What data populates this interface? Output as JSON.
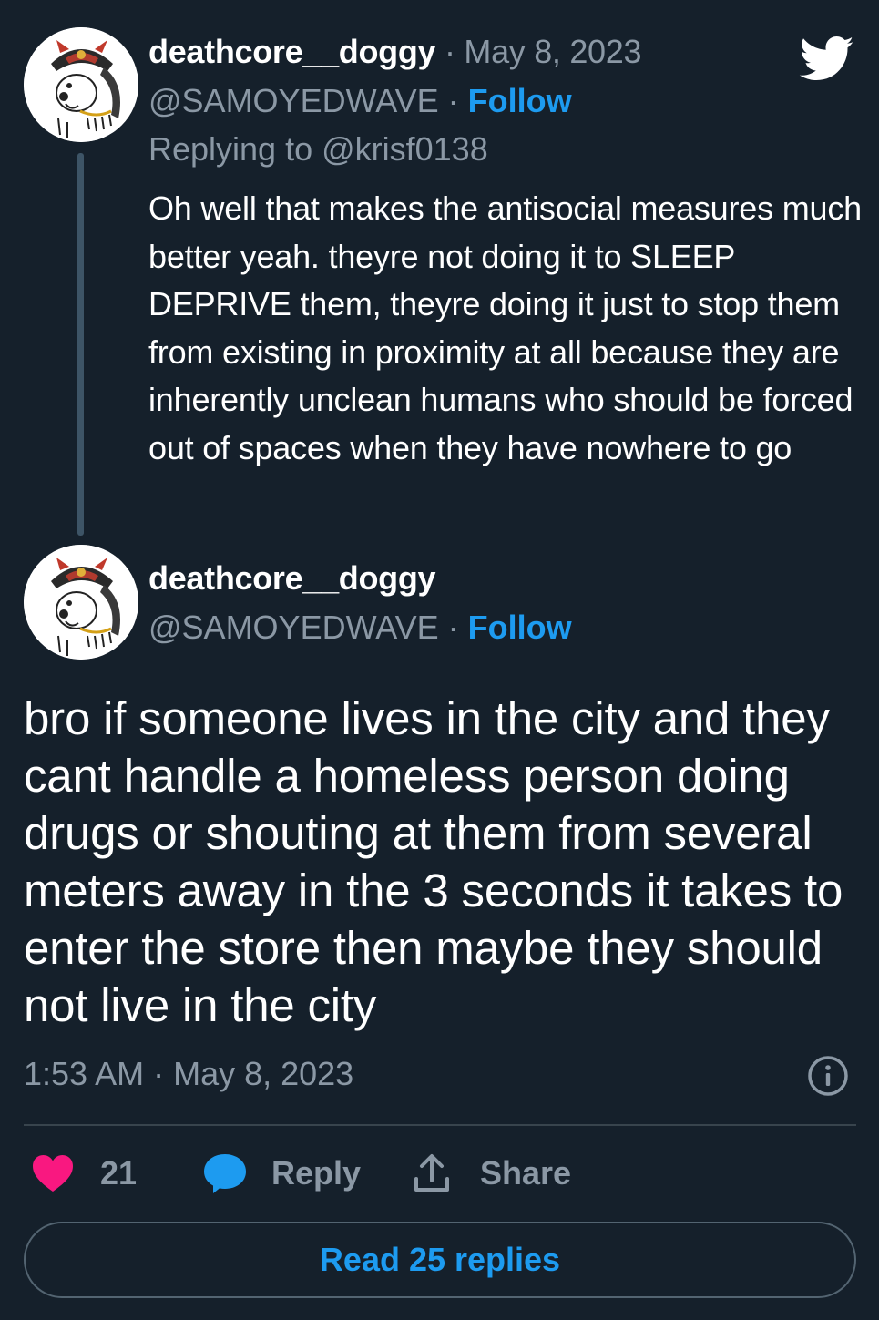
{
  "reply_tweet": {
    "display_name": "deathcore__doggy",
    "date": "May 8, 2023",
    "handle": "@SAMOYEDWAVE",
    "follow_label": "Follow",
    "replying_to": "Replying to @krisf0138",
    "text": "Oh well that makes the antisocial measures much better yeah. theyre not doing it to SLEEP DEPRIVE them, theyre doing it just to stop them from existing in proximity at all because they are inherently unclean humans who should be forced out of spaces when they have nowhere to go"
  },
  "main_tweet": {
    "display_name": "deathcore__doggy",
    "handle": "@SAMOYEDWAVE",
    "follow_label": "Follow",
    "text": "bro if someone lives in the city and they cant handle a homeless person doing drugs or shouting at them from several meters away in the 3 seconds it takes to enter the store then maybe they should not live in the city",
    "timestamp": "1:53 AM · May 8, 2023"
  },
  "separator": "·",
  "actions": {
    "likes": "21",
    "reply_label": "Reply",
    "share_label": "Share"
  },
  "read_replies_label": "Read 25 replies",
  "icons": {
    "brand": "twitter-bird-icon",
    "like": "heart-icon",
    "reply": "speech-bubble-icon",
    "share": "upload-share-icon",
    "info": "info-icon"
  },
  "colors": {
    "background": "#15202b",
    "link": "#1d9bf0",
    "muted": "#8b98a5",
    "heart": "#f91880",
    "reply_bubble": "#1d9bf0"
  }
}
